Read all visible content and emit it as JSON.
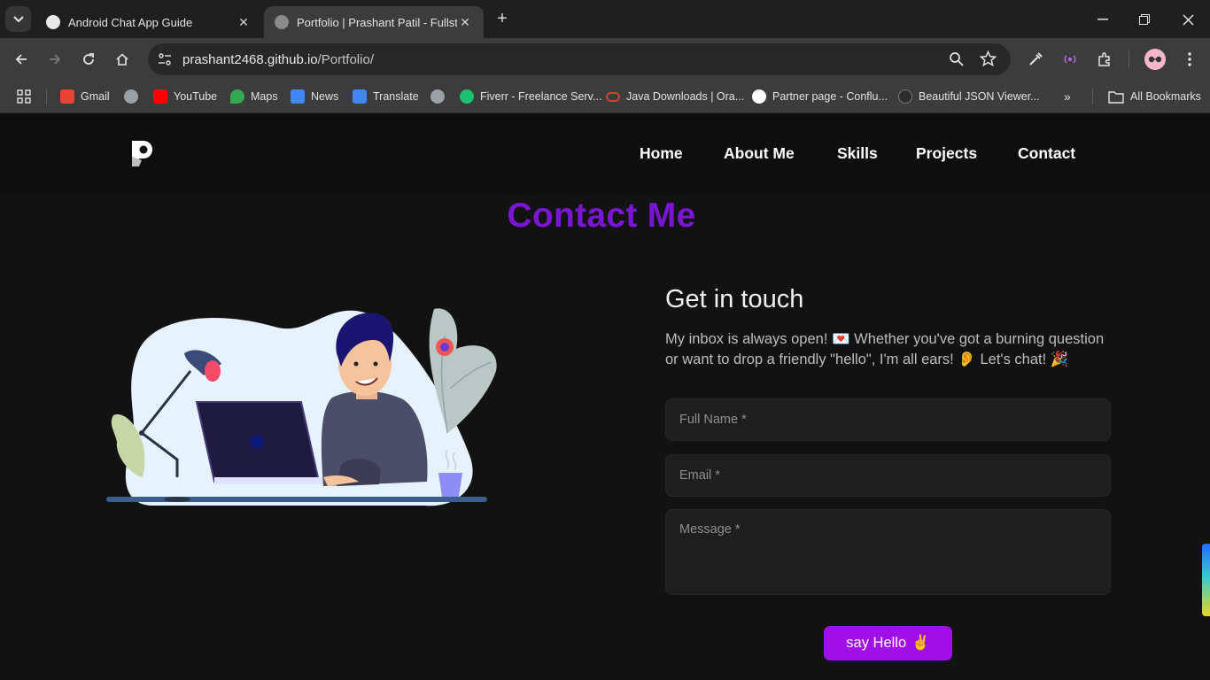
{
  "browser": {
    "tabs": [
      {
        "title": "Android Chat App Guide",
        "active": false
      },
      {
        "title": "Portfolio | Prashant Patil - Fullstack",
        "active": true
      }
    ],
    "url": {
      "host": "prashant2468.github.io",
      "path": "/Portfolio/"
    },
    "bookmarks": [
      {
        "label": "Gmail",
        "color": "#ea4335"
      },
      {
        "label": "",
        "color": "#9aa0a6"
      },
      {
        "label": "YouTube",
        "color": "#ff0000"
      },
      {
        "label": "Maps",
        "color": "#34a853"
      },
      {
        "label": "News",
        "color": "#4285f4"
      },
      {
        "label": "Translate",
        "color": "#4285f4"
      },
      {
        "label": "",
        "color": "#9aa0a6"
      },
      {
        "label": "Fiverr - Freelance Serv...",
        "color": "#1dbf73"
      },
      {
        "label": "Java Downloads | Ora...",
        "color": "#c74634"
      },
      {
        "label": "Partner page - Conflu...",
        "color": "#ffffff"
      },
      {
        "label": "Beautiful JSON Viewer...",
        "color": "#2d2d2d"
      }
    ],
    "all_bookmarks": "All Bookmarks"
  },
  "nav": {
    "items": [
      "Home",
      "About Me",
      "Skills",
      "Projects",
      "Contact"
    ]
  },
  "contact": {
    "title": "Contact Me",
    "heading": "Get in touch",
    "intro": "My inbox is always open! 💌 Whether you've got a burning question or want to drop a friendly \"hello\", I'm all ears! 👂 Let's chat! 🎉",
    "name_placeholder": "Full Name *",
    "email_placeholder": "Email *",
    "message_placeholder": "Message *",
    "submit_label": "say Hello",
    "submit_emoji": "✌️"
  },
  "colors": {
    "accent": "#a10fe8",
    "title": "#7a16d1",
    "background": "#121212"
  }
}
